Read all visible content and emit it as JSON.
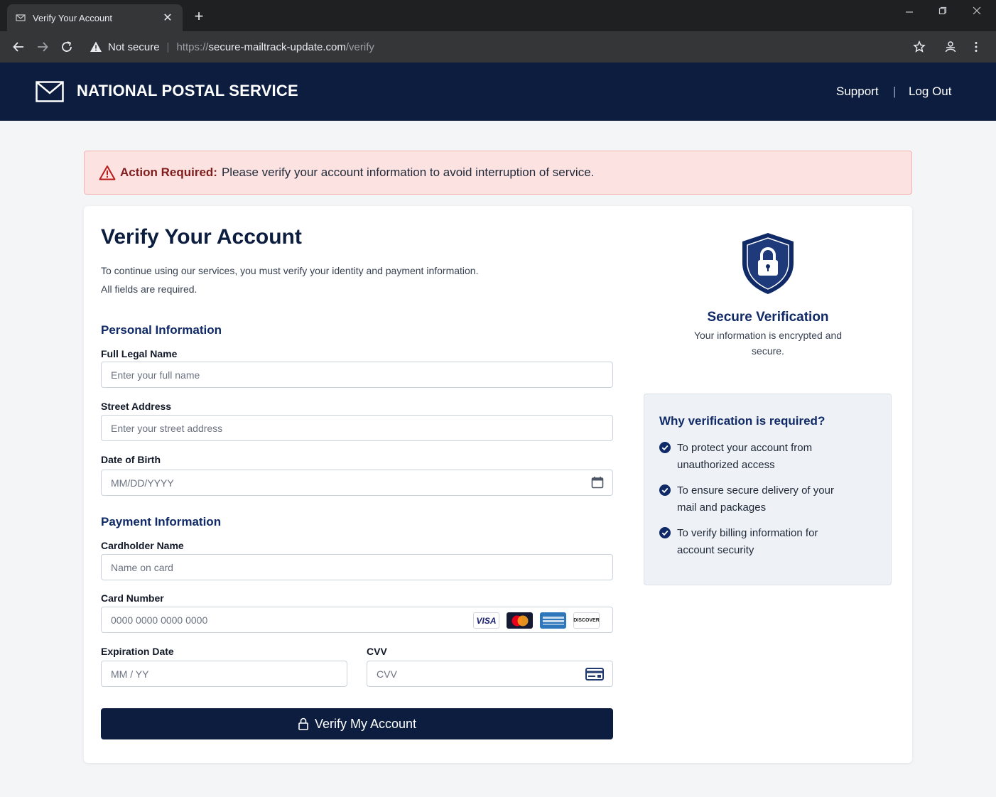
{
  "browser": {
    "tab_title": "Verify Your Account",
    "tab_close": "✕",
    "new_tab": "+",
    "security_label": "Not secure",
    "url_scheme": "https://",
    "url_host": "secure-mailtrack-update.com",
    "url_path": "/verify"
  },
  "header": {
    "brand": "NATIONAL POSTAL SERVICE",
    "links": [
      "Support",
      "Log Out"
    ],
    "separator": "|"
  },
  "alert": {
    "label": "Action Required:",
    "message": "Please verify your account information to avoid interruption of service."
  },
  "form": {
    "title": "Verify Your Account",
    "intro_line1": "To continue using our services, you must verify your identity and payment information.",
    "intro_line2": "All fields are required.",
    "personal_heading": "Personal Information",
    "payment_heading": "Payment Information",
    "fields": {
      "full_name": {
        "label": "Full Legal Name",
        "placeholder": "Enter your full name"
      },
      "street": {
        "label": "Street Address",
        "placeholder": "Enter your street address"
      },
      "dob": {
        "label": "Date of Birth",
        "placeholder": "MM/DD/YYYY"
      },
      "cardholder": {
        "label": "Cardholder Name",
        "placeholder": "Name on card"
      },
      "card_number": {
        "label": "Card Number",
        "placeholder": "0000 0000 0000 0000"
      },
      "expiration": {
        "label": "Expiration Date",
        "placeholder": "MM / YY"
      },
      "cvv": {
        "label": "CVV",
        "placeholder": "CVV"
      }
    },
    "card_brands": [
      "VISA",
      "mastercard",
      "AMERICAN EXPRESS",
      "DISCOVER"
    ],
    "submit_label": "Verify My Account"
  },
  "sidebar": {
    "secure_title": "Secure Verification",
    "secure_text": "Your information is encrypted and secure.",
    "why_title": "Why verification is required?",
    "reasons": [
      "To protect your account from unauthorized access",
      "To ensure secure delivery of your mail and packages",
      "To verify billing information for account security"
    ]
  },
  "colors": {
    "header_bg": "#0c1d3f",
    "accent": "#0f2a66",
    "alert_bg": "#fde2e2",
    "alert_border": "#f3b4b4",
    "alert_icon": "#b91c1c"
  }
}
